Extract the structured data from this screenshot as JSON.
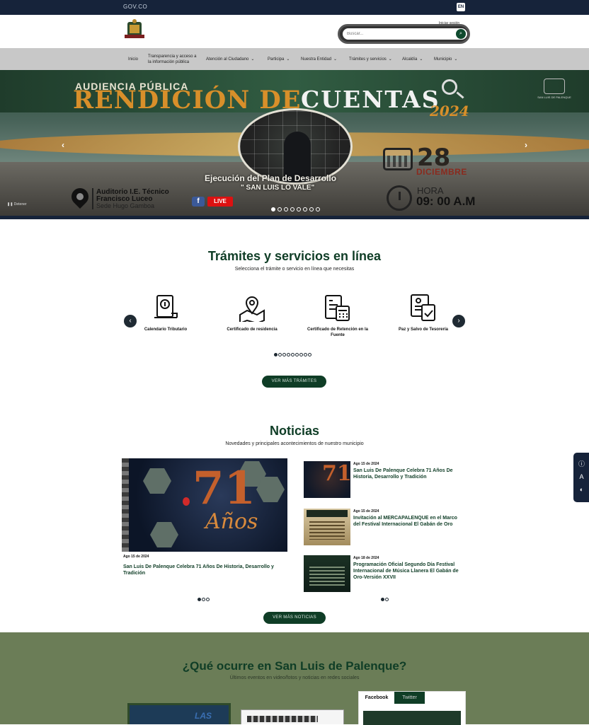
{
  "topbar": {
    "gov_logo": "GOV.CO",
    "lang": "EN"
  },
  "header": {
    "login": "Iniciar sesión",
    "search_placeholder": "Buscar...",
    "search_icon": "search-icon"
  },
  "nav": {
    "items": [
      {
        "label": "Inicio",
        "dropdown": false
      },
      {
        "label": "Transparencia y acceso a la información pública",
        "dropdown": false
      },
      {
        "label": "Atención al Ciudadano",
        "dropdown": true
      },
      {
        "label": "Participa",
        "dropdown": true
      },
      {
        "label": "Nuestra Entidad",
        "dropdown": true
      },
      {
        "label": "Trámites y servicios",
        "dropdown": true
      },
      {
        "label": "Alcaldía",
        "dropdown": true
      },
      {
        "label": "Municipio",
        "dropdown": true
      }
    ]
  },
  "hero": {
    "kicker": "AUDIENCIA PÚBLICA",
    "title_part1": "RENDICIÓN DE",
    "title_part2": "CUENTAS",
    "year": "2024",
    "seal_caption": "SAN LUIS DE PALENQUE",
    "subtitle": "Ejecución del Plan de Desarrollo",
    "slogan": "\" SAN LUIS LO VALE\"",
    "date_day": "28",
    "date_month": "DICIEMBRE",
    "time_label": "HORA",
    "time_value": "09: 00 A.M",
    "venue_line1": "Auditorio I.E. Técnico",
    "venue_line2": "Francisco Luceo",
    "venue_line3": "Sede Hugo Gamboa",
    "fb_label": "f",
    "live_label": "LIVE",
    "pause_label": "Detener",
    "slide_count": 8,
    "active_slide": 0
  },
  "tramites": {
    "title": "Trámites y servicios en línea",
    "subtitle": "Selecciona el trámite o servicio en línea que necesitas",
    "items": [
      {
        "label": "Calendario Tributario",
        "icon": "calendar-scroll-icon"
      },
      {
        "label": "Certificado de residencia",
        "icon": "map-pin-icon"
      },
      {
        "label": "Certificado de Retención en la Fuente",
        "icon": "calculator-document-icon"
      },
      {
        "label": "Paz y Salvo de Tesorería",
        "icon": "clipboard-check-icon"
      }
    ],
    "page_count": 9,
    "active_page": 0,
    "more_button": "VER MÁS TRÁMITES"
  },
  "noticias": {
    "title": "Noticias",
    "subtitle": "Novedades y principales acontecimientos de nuestro municipio",
    "featured": {
      "date": "Ago 15 de 2024",
      "title": "San Luis De Palenque Celebra 71 Años De Historia, Desarrollo y Tradición",
      "image_text": "71",
      "image_subtext": "Años"
    },
    "list": [
      {
        "date": "Ago 15 de 2024",
        "title": "San Luis De Palenque Celebra 71 Años De Historia, Desarrollo y Tradición"
      },
      {
        "date": "Ago 15 de 2024",
        "title": "Invitación al MERCAPALENQUE en el Marco del Festival Internacional El Gabán de Oro"
      },
      {
        "date": "Ago 18 de 2024",
        "title": "Programación Oficial Segundo Día Festival Internacional de Música Llanera El Gabán de Oro-Versión XXVII"
      }
    ],
    "featured_pages": 3,
    "list_pages": 2,
    "more_button": "VER MÁS NOTICIAS"
  },
  "ocurre": {
    "title": "¿Qué ocurre en San Luis de Palenque?",
    "subtitle": "Últimos eventos en video/fotos y noticias en redes sociales",
    "card_logo_text": "LAS",
    "tabs": [
      "Facebook",
      "Twitter"
    ],
    "active_tab": "Facebook"
  },
  "side_tools": [
    "info-icon",
    "text-size-icon",
    "contrast-icon"
  ],
  "colors": {
    "dark_navy": "#16233a",
    "brand_green": "#0f3d26",
    "footer_green": "#6b7d57",
    "nav_grey": "#c8c8c8"
  }
}
